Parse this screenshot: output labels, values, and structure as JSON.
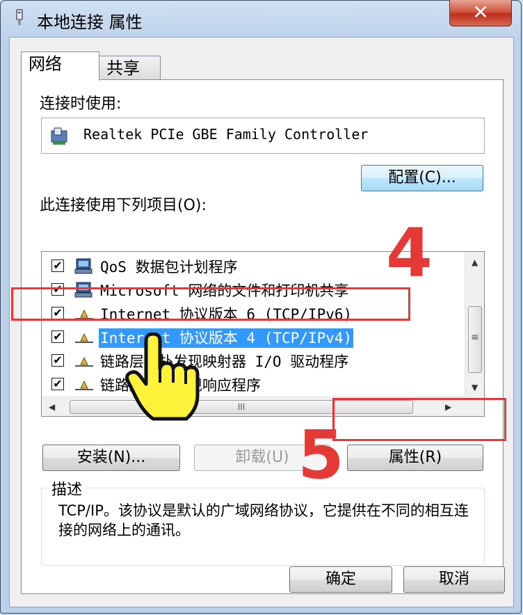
{
  "window": {
    "title": "本地连接 属性",
    "close_glyph": "✕"
  },
  "tabs": [
    {
      "label": "网络",
      "active": true
    },
    {
      "label": "共享",
      "active": false
    }
  ],
  "connect_using": {
    "label": "连接时使用:",
    "adapter_name": "Realtek PCIe GBE Family Controller",
    "configure_button": "配置(C)..."
  },
  "items_section": {
    "label": "此连接使用下列项目(O):",
    "items": [
      {
        "label": "QoS 数据包计划程序",
        "checked": true,
        "icon": "network-service-icon",
        "selected": false
      },
      {
        "label": "Microsoft 网络的文件和打印机共享",
        "checked": true,
        "icon": "network-service-icon",
        "selected": false
      },
      {
        "label": "Internet 协议版本 6 (TCP/IPv6)",
        "checked": true,
        "icon": "protocol-icon",
        "selected": false
      },
      {
        "label": "Internet 协议版本 4 (TCP/IPv4)",
        "checked": true,
        "icon": "protocol-icon",
        "selected": true
      },
      {
        "label": "链路层拓扑发现映射器 I/O 驱动程序",
        "checked": true,
        "icon": "protocol-icon",
        "selected": false
      },
      {
        "label": "链路层拓扑发现响应程序",
        "checked": true,
        "icon": "protocol-icon",
        "selected": false
      }
    ],
    "check_glyph": "✔",
    "hscroll_grip": "III",
    "vscroll_grip": "≡"
  },
  "item_buttons": {
    "install": "安装(N)...",
    "uninstall": "卸载(U)",
    "properties": "属性(R)"
  },
  "description": {
    "legend": "描述",
    "text": "TCP/IP。该协议是默认的广域网络协议，它提供在不同的相互连接的网络上的通讯。"
  },
  "footer": {
    "ok": "确定",
    "cancel": "取消"
  },
  "annotations": {
    "step_4": "4",
    "step_5": "5",
    "highlight_color": "#e53935"
  },
  "colors": {
    "selection": "#3399ff",
    "close_button": "#c83a27"
  }
}
